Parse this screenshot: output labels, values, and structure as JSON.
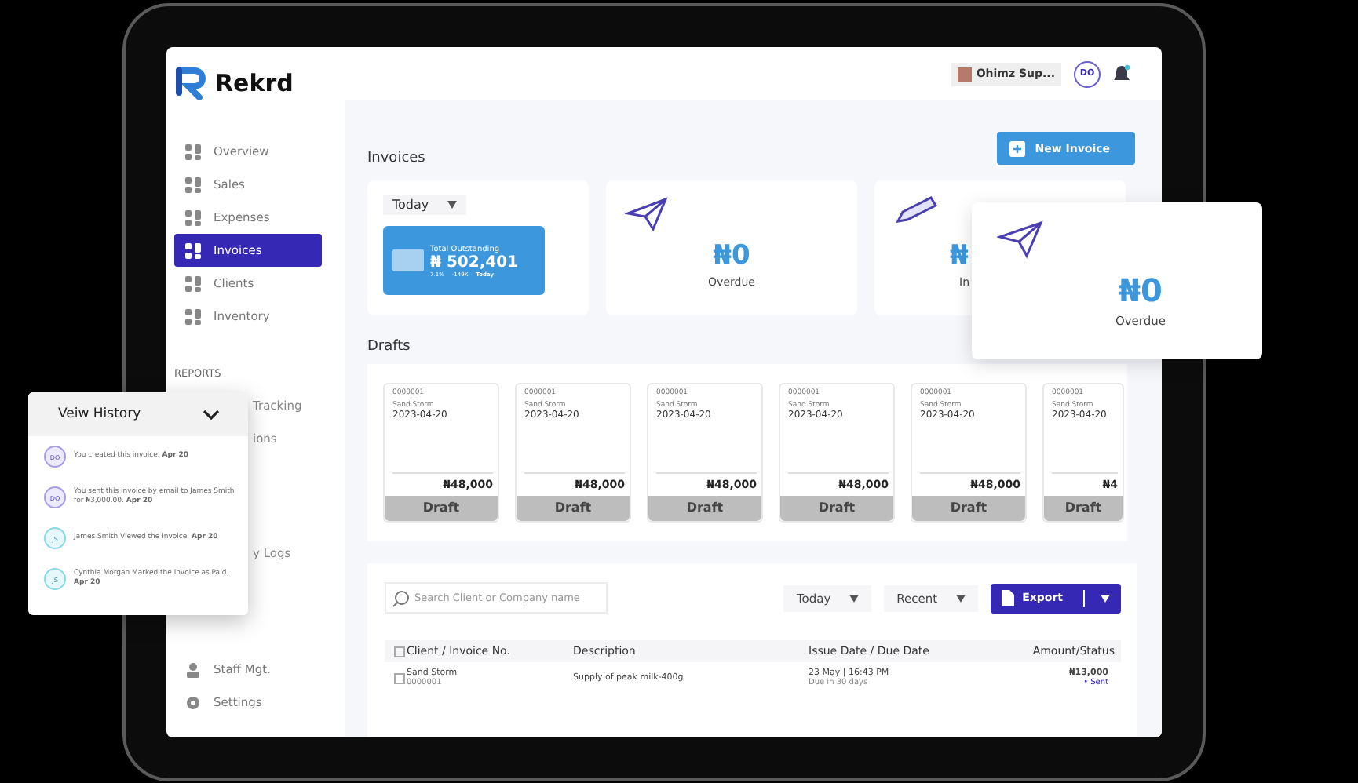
{
  "app": {
    "logo": "Rekrd",
    "company": "Ohimz Sup...",
    "avatar": "DO"
  },
  "sidebar": {
    "items": [
      {
        "label": "Overview",
        "selected": false
      },
      {
        "label": "Sales",
        "selected": false
      },
      {
        "label": "Expenses",
        "selected": false
      },
      {
        "label": "Invoices",
        "selected": true
      },
      {
        "label": "Clients",
        "selected": false
      },
      {
        "label": "Inventory",
        "selected": false
      }
    ],
    "section": "REPORTS",
    "report_items": [
      "Tracking",
      "ions",
      "y Logs"
    ],
    "footer_items": [
      {
        "label": "Staff Mgt.",
        "selected": false
      },
      {
        "label": "Settings",
        "selected": false
      }
    ]
  },
  "page": {
    "title": "Invoices",
    "new_button": "New Invoice"
  },
  "summary": {
    "period": "Today",
    "outstanding": {
      "label": "Total Outstanding",
      "amount": "₦ 502,401",
      "change": "7.1%",
      "delta": "-149K",
      "period": "Today"
    },
    "cards": [
      {
        "amount": "₦0",
        "label": "Overdue"
      },
      {
        "amount": "₦",
        "label": "In"
      }
    ]
  },
  "floating_card": {
    "amount": "₦0",
    "label": "Overdue"
  },
  "drafts": {
    "title": "Drafts",
    "cards": [
      {
        "number": "0000001",
        "client": "Sand Storm",
        "date": "2023-04-20",
        "amount": "₦48,000",
        "status": "Draft"
      },
      {
        "number": "0000001",
        "client": "Sand Storm",
        "date": "2023-04-20",
        "amount": "₦48,000",
        "status": "Draft"
      },
      {
        "number": "0000001",
        "client": "Sand Storm",
        "date": "2023-04-20",
        "amount": "₦48,000",
        "status": "Draft"
      },
      {
        "number": "0000001",
        "client": "Sand Storm",
        "date": "2023-04-20",
        "amount": "₦48,000",
        "status": "Draft"
      },
      {
        "number": "0000001",
        "client": "Sand Storm",
        "date": "2023-04-20",
        "amount": "₦48,000",
        "status": "Draft"
      },
      {
        "number": "0000001",
        "client": "Sand Storm",
        "date": "2023-04-20",
        "amount": "₦4",
        "status": "Draft"
      }
    ]
  },
  "table": {
    "search": {
      "placeholder": "Search Client or Company name"
    },
    "filters": [
      "Today",
      "Recent"
    ],
    "export": "Export",
    "select_all": {
      "checked": false
    },
    "columns": [
      "Client / Invoice No.",
      "Description",
      "Issue Date / Due Date",
      "Amount/Status"
    ],
    "rows": [
      {
        "checked": false,
        "client": "Sand Storm",
        "number": "0000001",
        "description": "Supply of peak milk-400g",
        "issue": "23 May | 16:43 PM",
        "due": "Due in 30 days",
        "amount": "₦13,000",
        "status": "• Sent"
      }
    ]
  },
  "history": {
    "title": "Veiw History",
    "entries": [
      {
        "initials": "DO",
        "kind": "user",
        "text": "You created this invoice. **Apr 20**"
      },
      {
        "initials": "DO",
        "kind": "user",
        "text": "You sent this invoice by email to James Smith for ₦3,000.00. **Apr 20**"
      },
      {
        "initials": "JS",
        "kind": "client",
        "text": "James Smith Viewed the invoice. **Apr 20**"
      },
      {
        "initials": "JS",
        "kind": "client",
        "text": "Cynthia Morgan Marked the invoice as Paid. **Apr 20**"
      }
    ]
  }
}
